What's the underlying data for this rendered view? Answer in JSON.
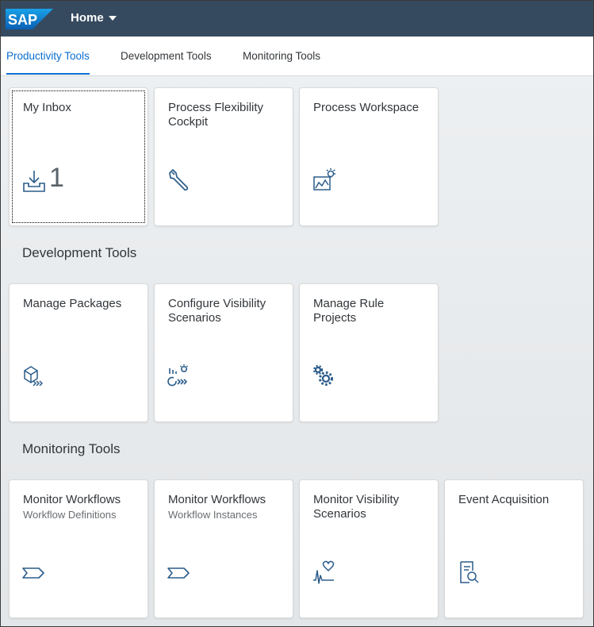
{
  "shell": {
    "logo_text": "SAP",
    "title": "Home",
    "bar_color": "#354a5f",
    "logo_color": "#0a6ed1"
  },
  "tabs": [
    {
      "label": "Productivity Tools",
      "active": true
    },
    {
      "label": "Development Tools",
      "active": false
    },
    {
      "label": "Monitoring Tools",
      "active": false
    }
  ],
  "sections": {
    "development": {
      "title": "Development Tools"
    },
    "monitoring": {
      "title": "Monitoring Tools"
    }
  },
  "tiles": {
    "my_inbox": {
      "title": "My Inbox",
      "count": "1",
      "icon": "inbox-download-icon"
    },
    "process_flexibility": {
      "title": "Process Flexibility Cockpit",
      "icon": "wrench-icon"
    },
    "process_workspace": {
      "title": "Process Workspace",
      "icon": "chart-lightbulb-icon"
    },
    "manage_packages": {
      "title": "Manage Packages",
      "icon": "package-icon"
    },
    "configure_visibility": {
      "title": "Configure Visibility Scenarios",
      "icon": "visibility-config-icon"
    },
    "manage_rule_projects": {
      "title": "Manage Rule Projects",
      "icon": "gears-icon"
    },
    "monitor_workflows_defs": {
      "title": "Monitor Workflows",
      "subtitle": "Workflow Definitions",
      "icon": "workflow-chevron-icon"
    },
    "monitor_workflows_inst": {
      "title": "Monitor Workflows",
      "subtitle": "Workflow Instances",
      "icon": "workflow-chevron-icon"
    },
    "monitor_visibility": {
      "title": "Monitor Visibility Scenarios",
      "icon": "heart-pulse-icon"
    },
    "event_acquisition": {
      "title": "Event Acquisition",
      "icon": "document-search-icon"
    }
  },
  "colors": {
    "icon": "#2c5d8a",
    "tab_active": "#0a6ed1"
  }
}
